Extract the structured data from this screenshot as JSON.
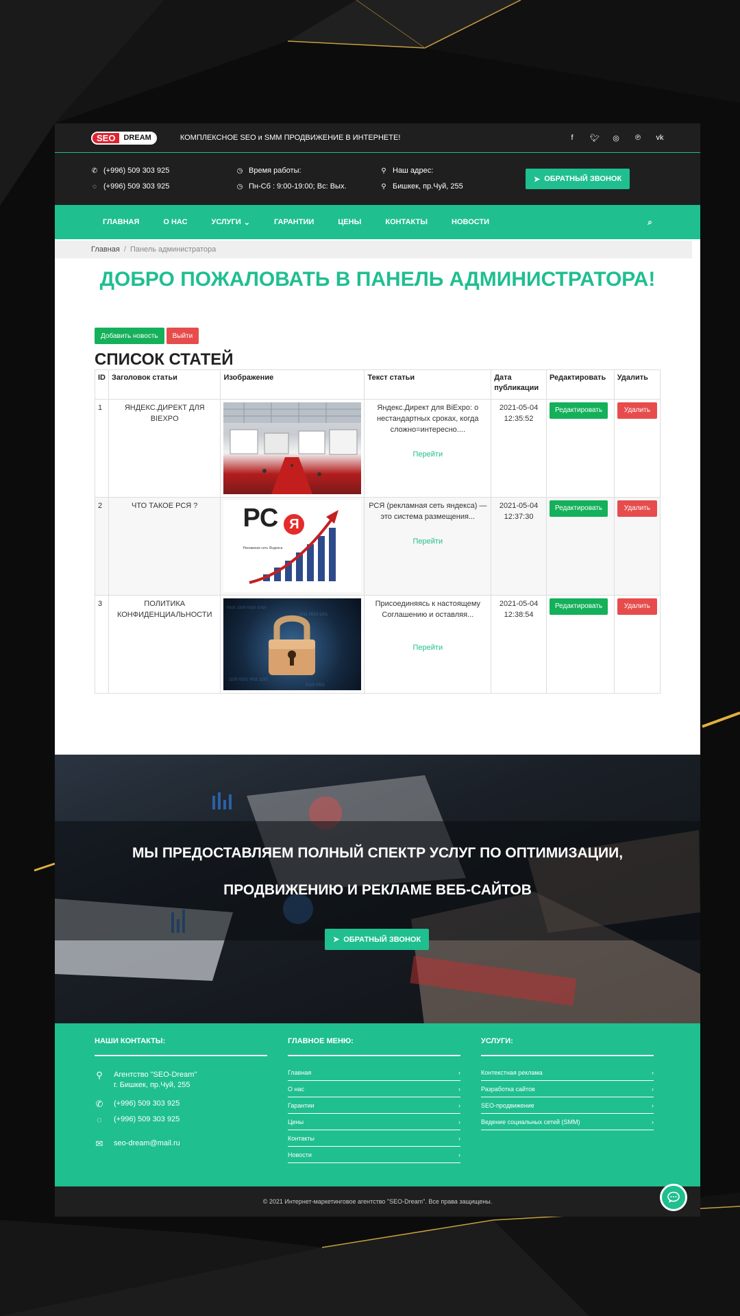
{
  "header": {
    "logo_seo": "SEO",
    "logo_dream": "DREAM",
    "tagline": "КОМПЛЕКСНОЕ SEO и SMM ПРОДВИЖЕНИЕ В ИНТЕРНЕТЕ!",
    "social": [
      "facebook-icon",
      "twitter-icon",
      "instagram-icon",
      "pinterest-icon",
      "vk-icon"
    ]
  },
  "info": {
    "phone1": "(+996) 509 303 925",
    "phone2": "(+996) 509 303 925",
    "hours_label": "Время работы:",
    "hours_value": "Пн-Сб : 9:00-19:00; Вс: Вых.",
    "address_label": "Наш адрес:",
    "address_value": "Бишкек, пр.Чуй, 255",
    "callback": "ОБРАТНЫЙ ЗВОНОК"
  },
  "nav": {
    "items": [
      "ГЛАВНАЯ",
      "О НАС",
      "УСЛУГИ",
      "ГАРАНТИИ",
      "ЦЕНЫ",
      "КОНТАКТЫ",
      "НОВОСТИ"
    ]
  },
  "breadcrumb": {
    "home": "Главная",
    "sep": "/",
    "current": "Панель администратора"
  },
  "main": {
    "welcome": "ДОБРО ПОЖАЛОВАТЬ В ПАНЕЛЬ АДМИНИСТРАТОРА!",
    "add_news": "Добавить новость",
    "logout": "Выйти",
    "list_title": "СПИСОК СТАТЕЙ"
  },
  "table": {
    "headers": [
      "ID",
      "Заголовок статьи",
      "Изображение",
      "Текст статьи",
      "Дата публикации",
      "Редактировать",
      "Удалить"
    ],
    "rows": [
      {
        "id": "1",
        "title": "ЯНДЕКС.ДИРЕКТ ДЛЯ BIEXPO",
        "text": "Яндекс.Директ для BiExpo: о нестандартных сроках, когда сложно=интересно....",
        "link": "Перейти",
        "date": "2021-05-04 12:35:52",
        "edit": "Редактировать",
        "delete": "Удалить"
      },
      {
        "id": "2",
        "title": "ЧТО ТАКОЕ РСЯ ?",
        "text": "РСЯ (рекламная сеть яндекса) — это система размещения...",
        "link": "Перейти",
        "date": "2021-05-04 12:37:30",
        "edit": "Редактировать",
        "delete": "Удалить"
      },
      {
        "id": "3",
        "title": "ПОЛИТИКА КОНФИДЕНЦИАЛЬНОСТИ",
        "text": "Присоединяясь к настоящему Соглашению и оставляя...",
        "link": "Перейти",
        "date": "2021-05-04 12:38:54",
        "edit": "Редактировать",
        "delete": "Удалить"
      }
    ],
    "rsya_logo": "РС",
    "rsya_ya": "Я",
    "rsya_caption": "Рекламная сеть Яндекса"
  },
  "banner": {
    "line1": "МЫ ПРЕДОСТАВЛЯЕМ ПОЛНЫЙ СПЕКТР УСЛУГ ПО ОПТИМИЗАЦИИ,",
    "line2": "ПРОДВИЖЕНИЮ И РЕКЛАМЕ ВЕБ-САЙТОВ",
    "callback": "ОБРАТНЫЙ ЗВОНОК"
  },
  "footer": {
    "contacts_title": "НАШИ КОНТАКТЫ:",
    "agency": "Агентство \"SEO-Dream\"",
    "address": "г. Бишкек, пр.Чуй, 255",
    "phone1": "(+996) 509 303 925",
    "phone2": "(+996) 509 303 925",
    "email": "seo-dream@mail.ru",
    "menu_title": "ГЛАВНОЕ МЕНЮ:",
    "menu": [
      "Главная",
      "О нас",
      "Гарантии",
      "Цены",
      "Контакты",
      "Новости"
    ],
    "services_title": "УСЛУГИ:",
    "services": [
      "Контекстная реклама",
      "Разработка сайтов",
      "SEO-продвижение",
      "Ведение социальных сетей (SMM)"
    ],
    "copyright": "© 2021 Интернет-маркетинговое агентство \"SEO-Dream\". Все права защищены."
  },
  "colors": {
    "accent": "#1fbf8f",
    "dark": "#1f1f1f",
    "green_button": "#14b05a",
    "red_button": "#e74c4c"
  }
}
